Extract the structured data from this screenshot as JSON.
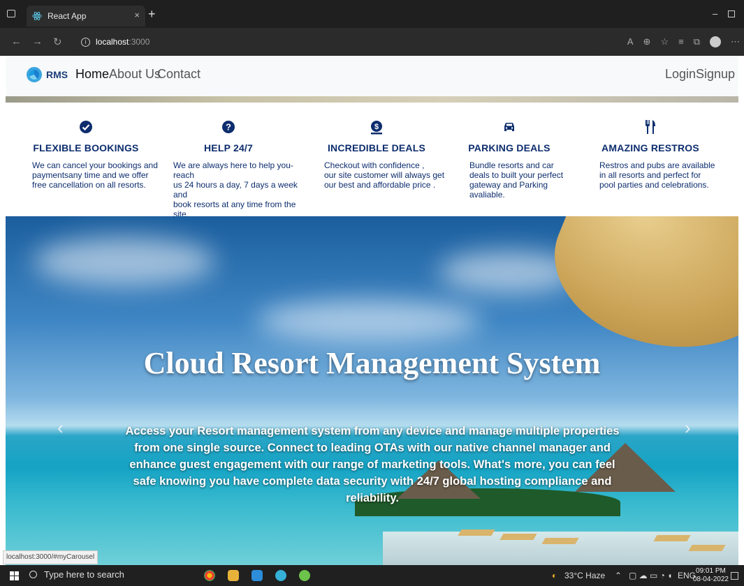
{
  "browser": {
    "tab_title": "React App",
    "tab_close": "×",
    "new_tab": "+",
    "url_host": "localhost",
    "url_port": ":3000",
    "status_url": "localhost:3000/#myCarousel"
  },
  "navbar": {
    "brand": "RMS",
    "links": [
      "Home",
      "About Us",
      "Contact"
    ],
    "right_links": [
      "Login",
      "Signup"
    ]
  },
  "features": [
    {
      "icon": "check-circle-icon",
      "title": "FLEXIBLE BOOKINGS",
      "lines": [
        "We can cancel your bookings and",
        "paymentsany time and we offer",
        "free cancellation on all resorts."
      ]
    },
    {
      "icon": "question-circle-icon",
      "title": "HELP 24/7",
      "lines": [
        "We are always here to help you-reach",
        "us 24 hours a day, 7 days a week and",
        "book resorts at any time from the site."
      ]
    },
    {
      "icon": "money-bag-icon",
      "title": "INCREDIBLE DEALS",
      "lines": [
        "Checkout with confidence ,",
        "our site customer will always get",
        "our best and affordable price ."
      ]
    },
    {
      "icon": "car-icon",
      "title": "PARKING DEALS",
      "lines": [
        "Bundle resorts and car",
        "deals to built your perfect",
        "gateway and Parking avaliable."
      ]
    },
    {
      "icon": "utensils-icon",
      "title": "AMAZING RESTROS",
      "lines": [
        "Restros and pubs are available",
        "in all resorts and perfect for",
        "pool parties and celebrations."
      ]
    }
  ],
  "hero": {
    "title": "Cloud Resort Management System",
    "description": "Access your Resort management system from any device and manage multiple properties from one single source. Connect to leading OTAs with our native channel manager and enhance guest engagement with our range of marketing tools. What's more, you can feel safe knowing you have complete data security with 24/7 global hosting compliance and reliability.",
    "prev": "‹",
    "next": "›"
  },
  "taskbar": {
    "search_placeholder": "Type here to search",
    "weather": "33°C  Haze",
    "lang": "ENG",
    "time": "09:01 PM",
    "date": "08-04-2022"
  }
}
